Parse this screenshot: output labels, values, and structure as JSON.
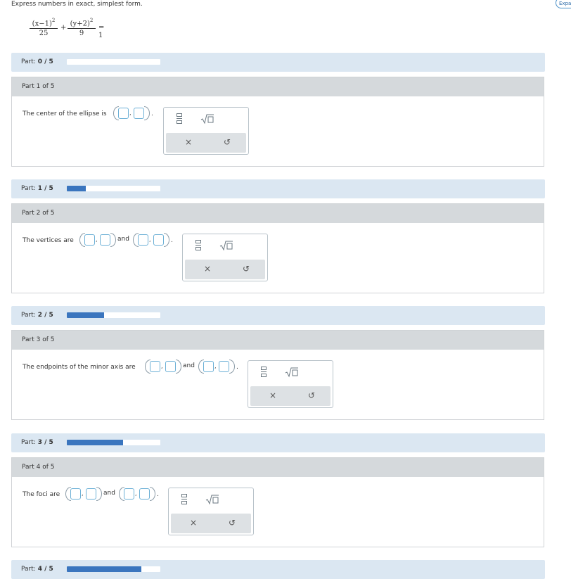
{
  "instructions": "Express numbers in exact, simplest form.",
  "expand_label": "Expa",
  "equation": {
    "term1_num": "(x−1)",
    "term1_den": "25",
    "term2_num": "(y+2)",
    "term2_den": "9",
    "exponent": "2",
    "plus": "+",
    "equals": "= 1"
  },
  "progress": [
    {
      "label": "Part:",
      "value": "0 / 5",
      "fraction": 0.0
    },
    {
      "label": "Part:",
      "value": "1 / 5",
      "fraction": 0.2
    },
    {
      "label": "Part:",
      "value": "2 / 5",
      "fraction": 0.4
    },
    {
      "label": "Part:",
      "value": "3 / 5",
      "fraction": 0.6
    },
    {
      "label": "Part:",
      "value": "4 / 5",
      "fraction": 0.8
    }
  ],
  "parts": [
    {
      "header": "Part 1 of 5",
      "question": "The center of the ellipse is"
    },
    {
      "header": "Part 2 of 5",
      "question": "The vertices are",
      "and": "and"
    },
    {
      "header": "Part 3 of 5",
      "question": "The endpoints of the minor axis are",
      "and": "and"
    },
    {
      "header": "Part 4 of 5",
      "question": "The foci are",
      "and": "and"
    }
  ],
  "palette": {
    "clear": "×",
    "undo": "↺"
  },
  "punct": {
    "comma": ",",
    "period": "."
  },
  "colors": {
    "progress_fill": "#3a75be",
    "progress_bg": "#dbe7f2",
    "input_border": "#6cb0d6"
  }
}
